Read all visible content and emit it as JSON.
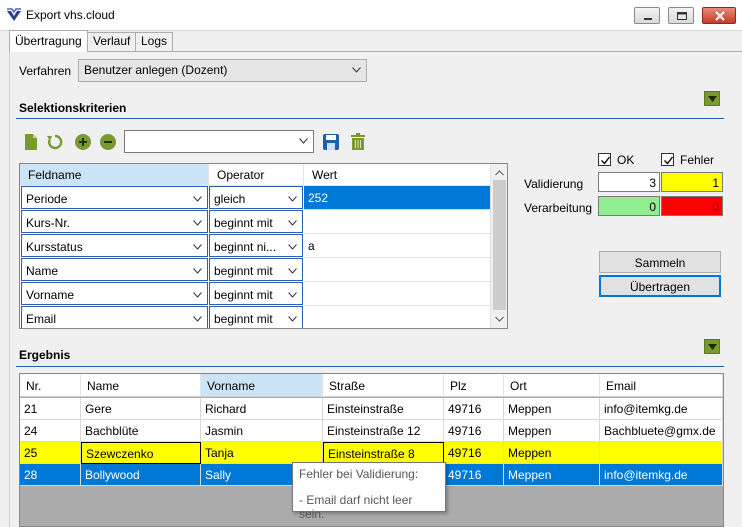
{
  "window": {
    "title": "Export vhs.cloud"
  },
  "tabs": [
    {
      "label": "Übertragung"
    },
    {
      "label": "Verlauf"
    },
    {
      "label": "Logs"
    }
  ],
  "verfahren": {
    "label": "Verfahren",
    "value": "Benutzer anlegen (Dozent)"
  },
  "sections": {
    "selektion": "Selektionskriterien",
    "ergebnis": "Ergebnis"
  },
  "filter_combo": {
    "value": ""
  },
  "criteria": {
    "headers": [
      "Feldname",
      "Operator",
      "Wert"
    ],
    "rows": [
      {
        "feld": "Periode",
        "op": "gleich",
        "wert": "252"
      },
      {
        "feld": "Kurs-Nr.",
        "op": "beginnt mit",
        "wert": ""
      },
      {
        "feld": "Kursstatus",
        "op": "beginnt ni...",
        "wert": "a"
      },
      {
        "feld": "Name",
        "op": "beginnt mit",
        "wert": ""
      },
      {
        "feld": "Vorname",
        "op": "beginnt mit",
        "wert": ""
      },
      {
        "feld": "Email",
        "op": "beginnt mit",
        "wert": ""
      }
    ]
  },
  "status": {
    "ok_label": "OK",
    "fehler_label": "Fehler",
    "validierung_label": "Validierung",
    "verarbeitung_label": "Verarbeitung",
    "validierung_ok": "3",
    "validierung_fehler": "1",
    "verarbeitung_ok": "0",
    "verarbeitung_fehler": "0"
  },
  "buttons": {
    "sammeln": "Sammeln",
    "uebertragen": "Übertragen"
  },
  "results": {
    "headers": [
      "Nr.",
      "Name",
      "Vorname",
      "Straße",
      "Plz",
      "Ort",
      "Email"
    ],
    "rows": [
      [
        "21",
        "Gere",
        "Richard",
        "Einsteinstraße",
        "49716",
        "Meppen",
        "info@itemkg.de"
      ],
      [
        "24",
        "Bachblüte",
        "Jasmin",
        "Einsteinstraße 12",
        "49716",
        "Meppen",
        "Bachbluete@gmx.de"
      ],
      [
        "25",
        "Szewczenko",
        "Tanja",
        "Einsteinstraße 8",
        "49716",
        "Meppen",
        ""
      ],
      [
        "28",
        "Bollywood",
        "Sally",
        "",
        "49716",
        "Meppen",
        "info@itemkg.de"
      ]
    ]
  },
  "tooltip": {
    "line1": "Fehler bei Validierung:",
    "line2": "- Email darf nicht leer sein."
  },
  "colors": {
    "selection": "#0078d7",
    "error_row": "#ffff00",
    "ok_green": "#90ee90",
    "error_red": "#ff0000",
    "accent_rule": "#2b5fa8"
  }
}
